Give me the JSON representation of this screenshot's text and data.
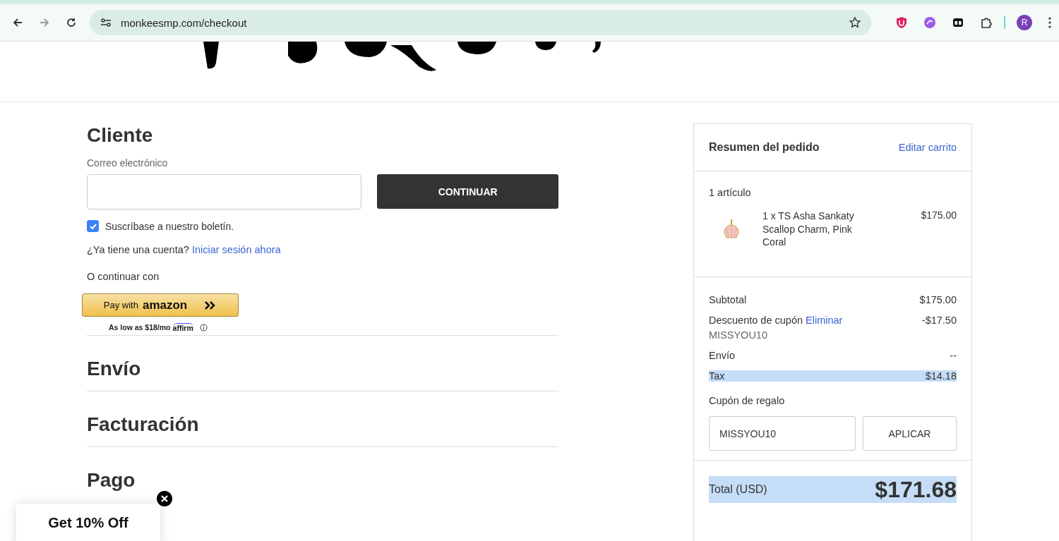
{
  "browser": {
    "url": "monkeesmp.com/checkout",
    "profile_initial": "R"
  },
  "customer": {
    "heading": "Cliente",
    "email_label": "Correo electrónico",
    "continue_button": "CONTINUAR",
    "newsletter": {
      "label": "Suscríbase a nuestro boletín.",
      "checked": true
    },
    "account_prompt": "¿Ya tiene una cuenta?",
    "sign_in_link": "Iniciar sesión ahora",
    "alt_label": "O continuar con",
    "amazon": {
      "pay_with": "Pay with",
      "brand": "amazon"
    },
    "affirm": {
      "text": "As low as $18/mo",
      "brand": "affirm"
    }
  },
  "sections": [
    {
      "heading": "Envío"
    },
    {
      "heading": "Facturación"
    },
    {
      "heading": "Pago"
    }
  ],
  "summary": {
    "title": "Resumen del pedido",
    "edit_link": "Editar carrito",
    "item_count": "1 artículo",
    "items": [
      {
        "name": "1 x TS Asha Sankaty Scallop Charm, Pink Coral",
        "price": "$175.00"
      }
    ],
    "rows": [
      {
        "label": "Subtotal",
        "value": "$175.00",
        "highlighted": false
      },
      {
        "label": "Descuento de cupón",
        "link": "Eliminar",
        "sublabel": "MISSYOU10",
        "value": "-$17.50",
        "highlighted": false
      },
      {
        "label": "Envío",
        "value": "--",
        "highlighted": false
      },
      {
        "label": "Tax",
        "value": "$14.18",
        "highlighted": true
      }
    ],
    "gift": {
      "label": "Cupón de regalo",
      "value": "MISSYOU10",
      "button": "APLICAR"
    },
    "total": {
      "label": "Total (USD)",
      "value": "$171.68",
      "highlighted": true
    }
  },
  "popup": {
    "text": "Get 10% Off"
  }
}
